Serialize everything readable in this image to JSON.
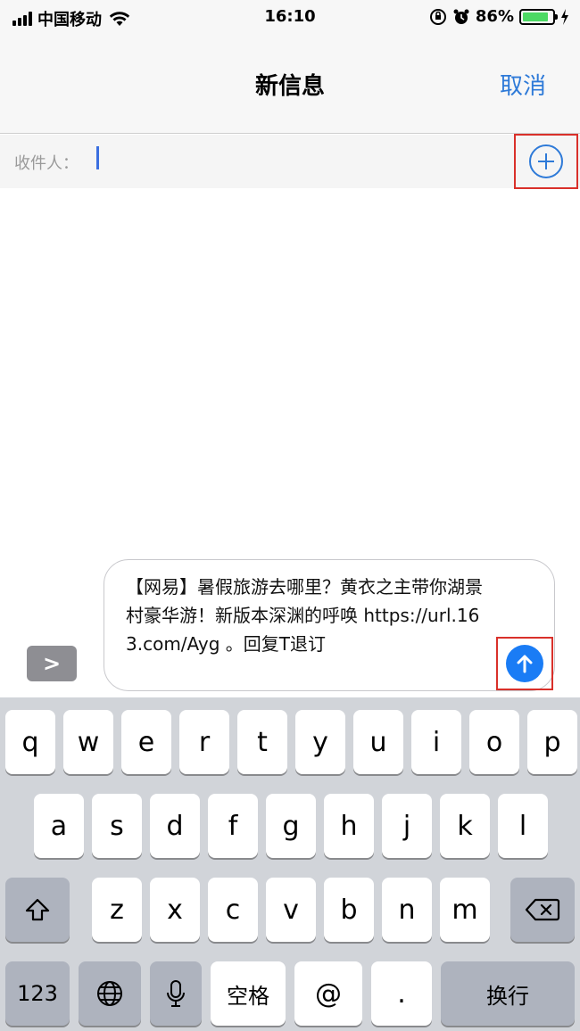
{
  "status_bar": {
    "carrier": "中国移动",
    "time": "16:10",
    "battery_percent": "86%",
    "battery_level": 0.86,
    "icons": [
      "signal-icon",
      "wifi-icon",
      "orientation-lock-icon",
      "alarm-icon",
      "battery-icon",
      "charging-icon"
    ]
  },
  "nav": {
    "title": "新信息",
    "cancel_label": "取消",
    "accent_color": "#2e7ad8"
  },
  "recipient": {
    "label": "收件人：",
    "value": ""
  },
  "composer": {
    "expand_label": ">",
    "message": "【网易】暑假旅游去哪里？黄衣之主带你湖景村豪华游！新版本深渊的呼唤 https://url.163.com/Ayg 。回复T退订",
    "send_color": "#1a7cf5"
  },
  "keyboard": {
    "row1": [
      "q",
      "w",
      "e",
      "r",
      "t",
      "y",
      "u",
      "i",
      "o",
      "p"
    ],
    "row2": [
      "a",
      "s",
      "d",
      "f",
      "g",
      "h",
      "j",
      "k",
      "l"
    ],
    "row3": [
      "z",
      "x",
      "c",
      "v",
      "b",
      "n",
      "m"
    ],
    "numbers_label": "123",
    "space_label": "空格",
    "at_label": "@",
    "dot_label": ".",
    "return_label": "换行"
  }
}
